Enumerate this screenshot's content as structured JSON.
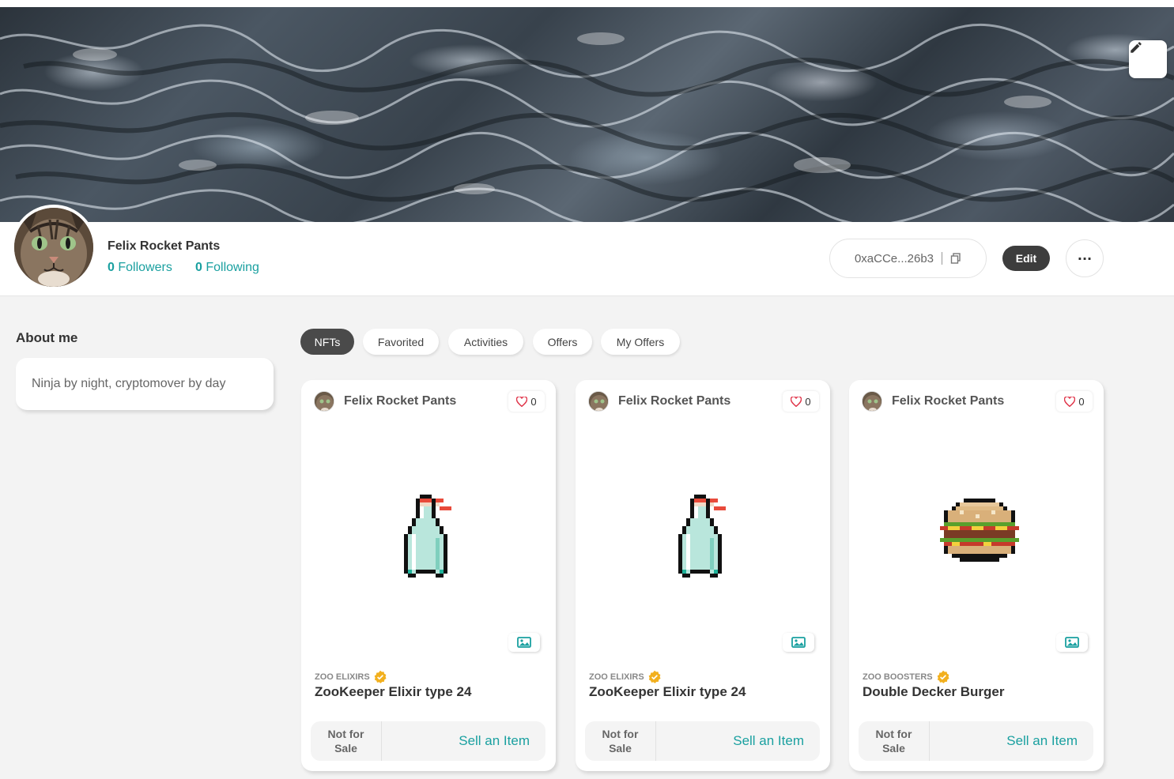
{
  "profile": {
    "name": "Felix Rocket Pants",
    "followers_count": "0",
    "followers_label": "Followers",
    "following_count": "0",
    "following_label": "Following",
    "wallet_address": "0xaCCe...26b3",
    "edit_label": "Edit",
    "more_label": "···"
  },
  "about": {
    "title": "About me",
    "bio": "Ninja by night, cryptomover by day"
  },
  "tabs": [
    {
      "label": "NFTs",
      "active": true
    },
    {
      "label": "Favorited",
      "active": false
    },
    {
      "label": "Activities",
      "active": false
    },
    {
      "label": "Offers",
      "active": false
    },
    {
      "label": "My Offers",
      "active": false
    }
  ],
  "cards": [
    {
      "owner": "Felix Rocket Pants",
      "likes": "0",
      "collection": "ZOO ELIXIRS",
      "name": "ZooKeeper Elixir type 24",
      "status": "Not for Sale",
      "status_line1": "Not for",
      "status_line2": "Sale",
      "action": "Sell an Item",
      "art": "elixir-bottle"
    },
    {
      "owner": "Felix Rocket Pants",
      "likes": "0",
      "collection": "ZOO ELIXIRS",
      "name": "ZooKeeper Elixir type 24",
      "status": "Not for Sale",
      "status_line1": "Not for",
      "status_line2": "Sale",
      "action": "Sell an Item",
      "art": "elixir-bottle"
    },
    {
      "owner": "Felix Rocket Pants",
      "likes": "0",
      "collection": "ZOO BOOSTERS",
      "name": "Double Decker Burger",
      "status": "Not for Sale",
      "status_line1": "Not for",
      "status_line2": "Sale",
      "action": "Sell an Item",
      "art": "burger"
    }
  ],
  "icons": {
    "edit_banner": "pencil-icon",
    "copy": "copy-icon",
    "heart": "heart-icon",
    "verified": "verified-badge-icon",
    "media": "image-icon"
  },
  "colors": {
    "accent": "#1aa0a0",
    "dark_button": "#3d3d3d",
    "heart": "#e0354a",
    "verified": "#f2b01e"
  }
}
